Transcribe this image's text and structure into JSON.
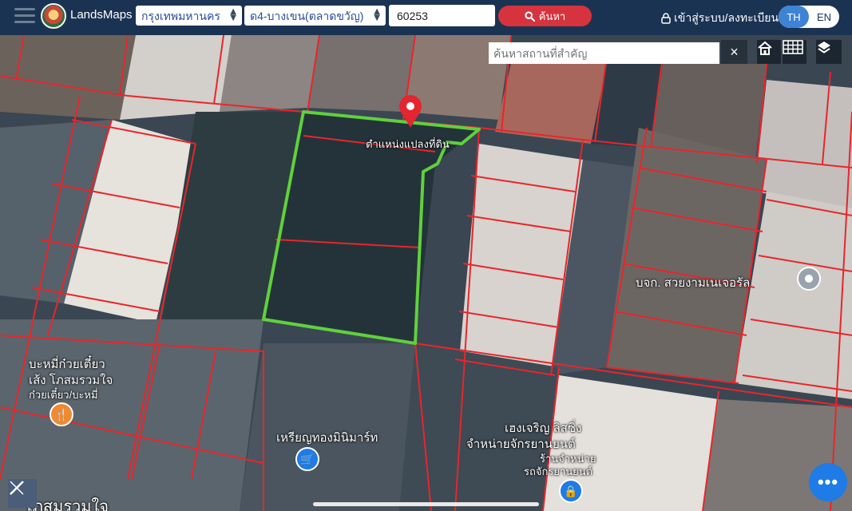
{
  "header": {
    "app_name": "LandsMaps",
    "province_select": "กรุงเทพมหานคร",
    "district_select": "ด4-บางเขน(ตลาดขวัญ)",
    "parcel_number": "60253",
    "search_button": "ค้นหา",
    "login_label": "เข้าสู่ระบบ/ลงทะเบียน",
    "lang_th": "TH",
    "lang_en": "EN"
  },
  "map": {
    "place_search_placeholder": "ค้นหาสถานที่สำคัญ",
    "pin_label": "ตำแหน่งแปลงที่ดิน",
    "labels": {
      "business_right": "บจก. สวยงามเนเจอรัล",
      "noodle_shop_1": "บะหมี่ก๋วยเตี๋ยว",
      "noodle_shop_2": "เส้ง โภสมรวมใจ",
      "noodle_shop_3": "ก๋วยเตี๋ยว/บะหมี่",
      "gold_shop": "เหรียญทองมินิมาร์ท",
      "moto_1": "เฮงเจริญ ลิสซิ่ง",
      "moto_2": "จำหน่ายจักรยานยนต์",
      "moto_3": "ร้านจำหน่าย",
      "moto_4": "รถจักรยานยนต์",
      "road": "โภสมรวมใจ"
    },
    "icons": {
      "restaurant": "fork-knife-icon",
      "shop": "cart-icon",
      "lock": "lock-icon",
      "location": "location-pin-icon"
    },
    "colors": {
      "parcel_lines": "#e8262b",
      "selected_parcel": "#5fd13d",
      "pin": "#e3262f",
      "restaurant_poi": "#f08a30",
      "shop_poi": "#1f7be6"
    },
    "fab_label": "•••"
  }
}
